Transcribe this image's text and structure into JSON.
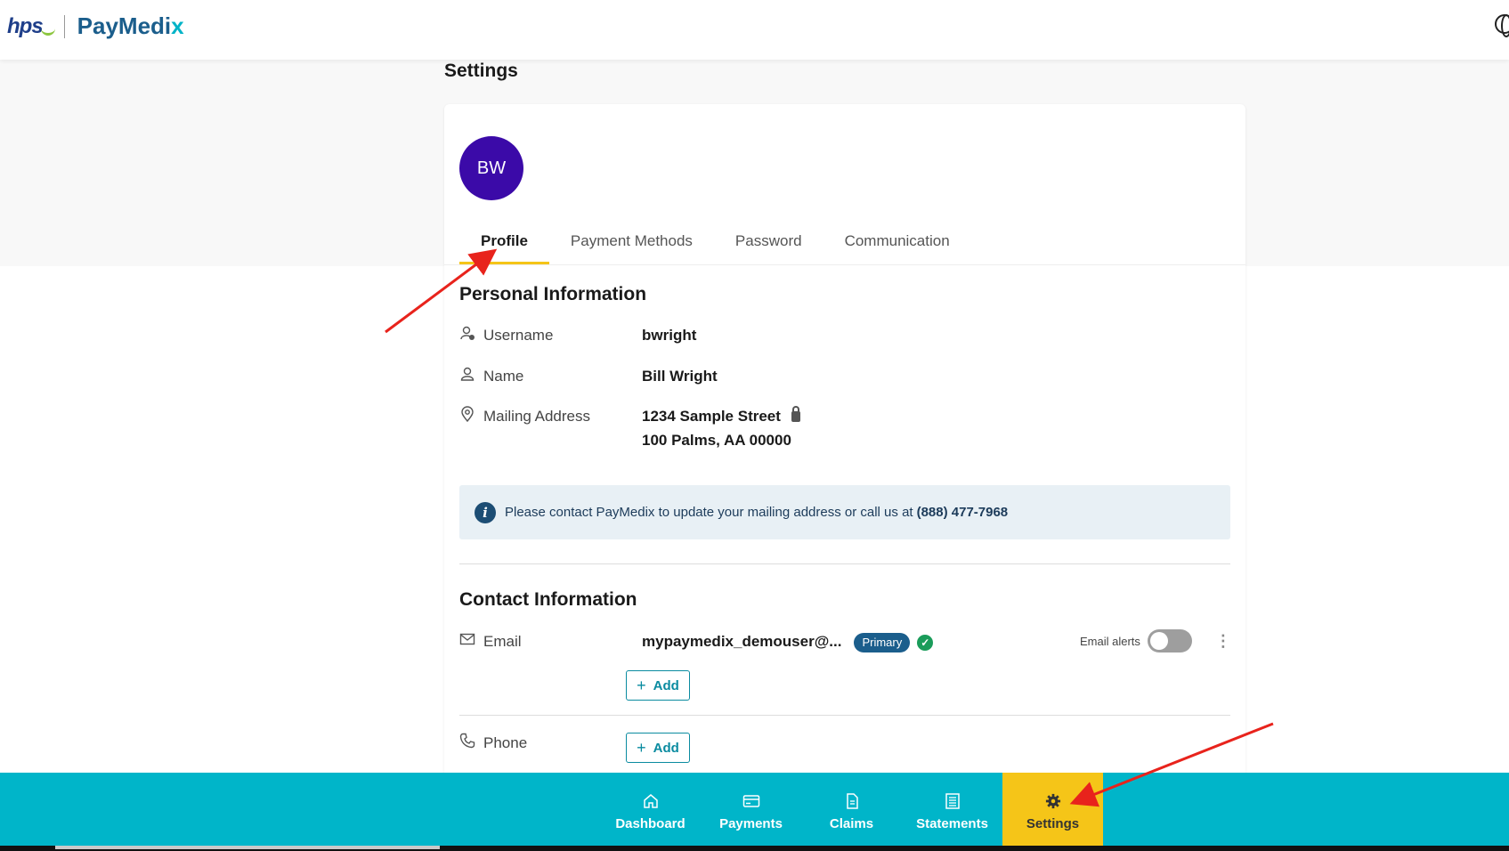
{
  "header": {
    "logo_hps": "hps",
    "logo_paymedix_main": "PayMedi",
    "logo_paymedix_x": "x",
    "globe_icon": "globe-icon"
  },
  "page": {
    "title": "Settings"
  },
  "profile": {
    "avatar_initials": "BW"
  },
  "tabs": [
    {
      "label": "Profile",
      "active": true
    },
    {
      "label": "Payment Methods",
      "active": false
    },
    {
      "label": "Password",
      "active": false
    },
    {
      "label": "Communication",
      "active": false
    }
  ],
  "personal": {
    "title": "Personal Information",
    "username_label": "Username",
    "username_value": "bwright",
    "name_label": "Name",
    "name_value": "Bill Wright",
    "address_label": "Mailing Address",
    "address_line1": "1234 Sample Street",
    "address_line2": "100 Palms, AA 00000"
  },
  "info": {
    "text": "Please contact PayMedix to update your mailing address or call us at",
    "phone": "(888) 477-7968"
  },
  "contact": {
    "title": "Contact Information",
    "email_label": "Email",
    "email_value": "mypaymedix_demouser@...",
    "primary_badge": "Primary",
    "email_alerts_label": "Email alerts",
    "email_alerts_on": false,
    "add_label": "Add",
    "phone_label": "Phone"
  },
  "bottom_nav": [
    {
      "label": "Dashboard",
      "icon": "home-icon",
      "active": false
    },
    {
      "label": "Payments",
      "icon": "credit-card-icon",
      "active": false
    },
    {
      "label": "Claims",
      "icon": "document-icon",
      "active": false
    },
    {
      "label": "Statements",
      "icon": "statement-icon",
      "active": false
    },
    {
      "label": "Settings",
      "icon": "gear-icon",
      "active": true
    }
  ],
  "colors": {
    "brand_teal": "#00b5c9",
    "accent_yellow": "#f5c518",
    "avatar_purple": "#3b0aa8",
    "badge_blue": "#1b5e8c",
    "annotation_red": "#e8231c"
  }
}
